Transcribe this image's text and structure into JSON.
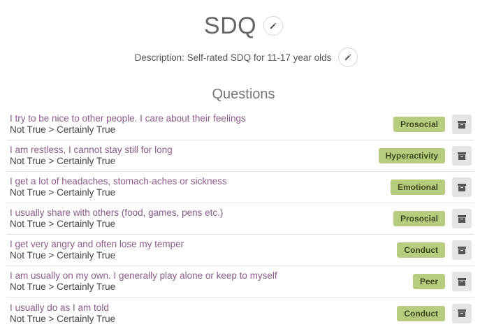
{
  "header": {
    "title": "SDQ",
    "description": "Description: Self-rated SDQ for 11-17 year olds",
    "edit_icon": "pencil-icon"
  },
  "section": {
    "title": "Questions"
  },
  "colors": {
    "tag_bg": "#b7cc7e",
    "link": "#8a5a8a",
    "archive_bg": "#e4e4e4"
  },
  "questions": [
    {
      "text": "I try to be nice to other people. I care about their feelings",
      "scale": "Not True > Certainly True",
      "tag": "Prosocial"
    },
    {
      "text": "I am restless, I cannot stay still for long",
      "scale": "Not True > Certainly True",
      "tag": "Hyperactivity"
    },
    {
      "text": "I get a lot of headaches, stomach-aches or sickness",
      "scale": "Not True > Certainly True",
      "tag": "Emotional"
    },
    {
      "text": "I usually share with others (food, games, pens etc.)",
      "scale": "Not True > Certainly True",
      "tag": "Prosocial"
    },
    {
      "text": "I get very angry and often lose my temper",
      "scale": "Not True > Certainly True",
      "tag": "Conduct"
    },
    {
      "text": "I am usually on my own. I generally play alone or keep to myself",
      "scale": "Not True > Certainly True",
      "tag": "Peer"
    },
    {
      "text": "I usually do as I am told",
      "scale": "Not True > Certainly True",
      "tag": "Conduct"
    }
  ]
}
